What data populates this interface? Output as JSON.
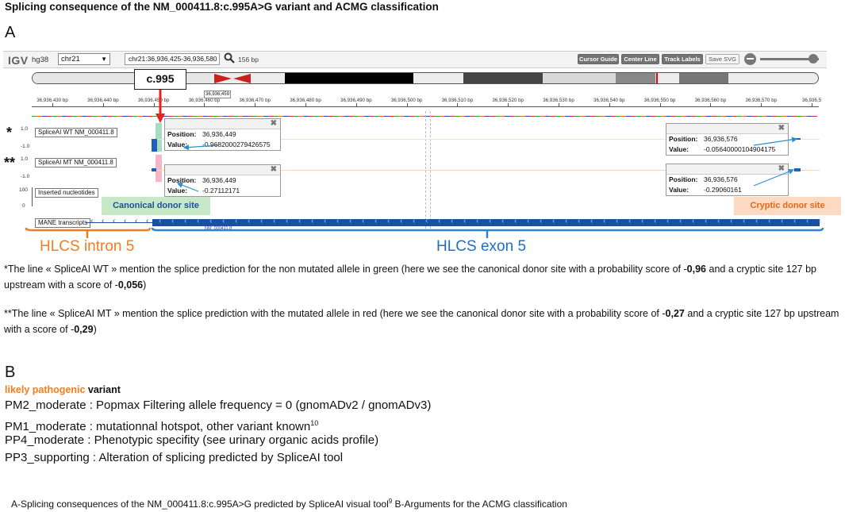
{
  "title": "Splicing consequence of the NM_000411.8:c.995A>G variant and ACMG classification",
  "panel_a": "A",
  "panel_b": "B",
  "igv": {
    "logo": "IGV",
    "genome": "hg38",
    "chromosome": "chr21",
    "locus": "chr21:36,936,425-36,936,580",
    "width_label": "156 bp",
    "buttons": [
      "Cursor Guide",
      "Center Line",
      "Track Labels",
      "Save SVG"
    ],
    "icons": {
      "search": "search-icon",
      "zoom_out": "zoom-minus-icon",
      "zoom": "zoom-slider"
    },
    "ruler_ticks": [
      "36,936,430 bp",
      "36,936,440 bp",
      "36,936,450 bp",
      "36,936,460 bp",
      "36,936,470 bp",
      "36,936,480 bp",
      "36,936,490 bp",
      "36,936,500 bp",
      "36,936,510 bp",
      "36,936,520 bp",
      "36,936,530 bp",
      "36,936,540 bp",
      "36,936,550 bp",
      "36,936,560 bp",
      "36,936,570 bp",
      "36,936,5"
    ],
    "cursor_label": "36,936,459",
    "variant_callout": "c.995",
    "tracks": {
      "wt": {
        "marker": "*",
        "label": "SpliceAI WT NM_000411.8",
        "axis_top": "1.0",
        "axis_bottom": "-1.0"
      },
      "mt": {
        "marker": "**",
        "label": "SpliceAI MT NM_000411.8",
        "axis_top": "1.0",
        "axis_bottom": "-1.0"
      },
      "inserted": {
        "label": "Inserted nucleotides",
        "axis_top": "100",
        "axis_bottom": "0"
      },
      "mane": {
        "label": "MANE transcripts",
        "transcript_id": "NM_000411.8"
      }
    },
    "popups": [
      {
        "position_key": "Position:",
        "position": "36,936,449",
        "value_key": "Value:",
        "value": "-0.9682000279426575"
      },
      {
        "position_key": "Position:",
        "position": "36,936,449",
        "value_key": "Value:",
        "value": "-0.27112171"
      },
      {
        "position_key": "Position:",
        "position": "36,936,576",
        "value_key": "Value:",
        "value": "-0.05640000104904175"
      },
      {
        "position_key": "Position:",
        "position": "36,936,576",
        "value_key": "Value:",
        "value": "-0.29060161"
      }
    ],
    "canonical_site": "Canonical donor site",
    "cryptic_site": "Cryptic donor site",
    "intron_label": "HLCS intron 5",
    "exon_label": "HLCS exon 5",
    "colors": {
      "wt_bar": "#1f5fbf",
      "wt_highlight": "#a8dcc2",
      "mt_highlight": "#f5b7c6",
      "arrow_red": "#e8231b",
      "canonical_box": "#c6e8c6",
      "cryptic_box": "#fbd9c2",
      "intron_orange": "#ef7d22",
      "exon_blue": "#1f6fc0",
      "transcript_blue": "#1b4fa0"
    }
  },
  "notes": {
    "wt": {
      "pre": "*The line « SpliceAI WT » mention the splice prediction for the non mutated allele in green (here we see the canonical donor site with a probability score of -",
      "score1": "0,96",
      "mid": " and a cryptic site 127 bp upstream with a score of -",
      "score2": "0,056",
      "post": ")"
    },
    "mt": {
      "pre": "**The line « SpliceAI MT » mention the splice prediction with the mutated allele in red (here we see the canonical donor site with a probability score of -",
      "score1": "0,27",
      "mid": " and a cryptic site 127 bp upstream with a score of -",
      "score2": "0,29",
      "post": ")"
    }
  },
  "classification": {
    "verdict_orange": "likely pathogenic",
    "verdict_black": "variant",
    "criteria": [
      {
        "text": "PM2_moderate : Popmax Filtering allele frequency = 0 (gnomADv2 / gnomADv3)",
        "sup": ""
      },
      {
        "text": "PM1_moderate : mutationnal hotspot, other variant known",
        "sup": "10"
      },
      {
        "text": "PP4_moderate : Phenotypic specifity (see urinary organic acids profile)",
        "sup": ""
      },
      {
        "text": "PP3_supporting : Alteration of splicing predicted by SpliceAI tool",
        "sup": ""
      }
    ]
  },
  "caption": {
    "pre": "A-Splicing consequences of the NM_000411.8:c.995A>G predicted by SpliceAI visual tool",
    "sup": "9",
    "post": " B-Arguments for the ACMG classification"
  }
}
